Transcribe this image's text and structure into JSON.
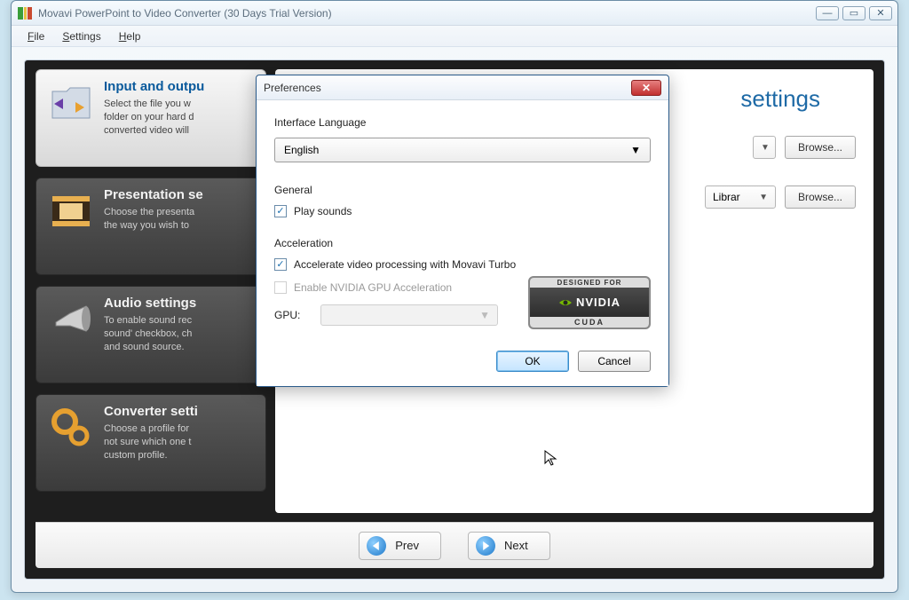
{
  "app": {
    "title": "Movavi PowerPoint to Video Converter (30 Days Trial Version)"
  },
  "menu": {
    "file": "File",
    "settings": "Settings",
    "help": "Help"
  },
  "steps": [
    {
      "title": "Input and outpu",
      "desc": "Select the file you w\nfolder on your hard d\nconverted video will "
    },
    {
      "title": "Presentation se",
      "desc": "Choose the presenta\nthe way you wish to "
    },
    {
      "title": "Audio settings",
      "desc": "To enable sound rec\nsound' checkbox, ch\nand sound source."
    },
    {
      "title": "Converter setti",
      "desc": "Choose a profile for\nnot sure which one t\ncustom profile."
    }
  ],
  "right": {
    "title_fragment": "settings",
    "combo2_text": "Librar",
    "browse": "Browse..."
  },
  "nav": {
    "prev": "Prev",
    "next": "Next"
  },
  "dialog": {
    "title": "Preferences",
    "lang_label": "Interface Language",
    "lang_value": "English",
    "general_label": "General",
    "play_sounds": "Play sounds",
    "accel_label": "Acceleration",
    "accel_turbo": "Accelerate video processing with Movavi Turbo",
    "accel_nvidia": "Enable NVIDIA GPU Acceleration",
    "gpu_label": "GPU:",
    "ok": "OK",
    "cancel": "Cancel",
    "badge": {
      "designed": "DESIGNED FOR",
      "brand": "NVIDIA",
      "cuda": "CUDA"
    }
  }
}
